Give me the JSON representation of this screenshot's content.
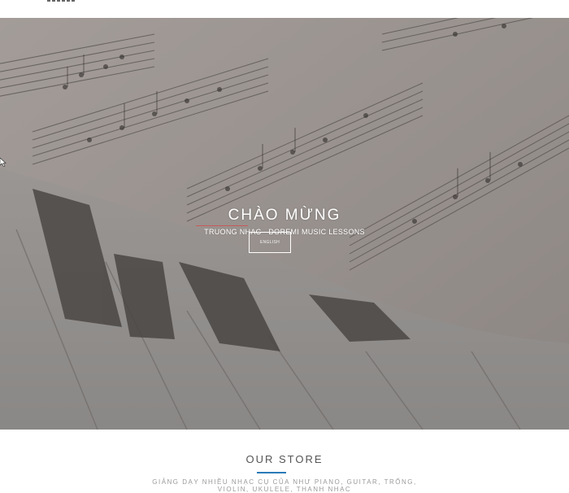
{
  "hero": {
    "title": "CHÀO MỪNG",
    "subtitle": "TRUONG NHAC  - DOREMI MUSIC LESSONS",
    "language_button": "ENGLISH"
  },
  "store": {
    "title": "OUR STORE",
    "description_line1": "GIẢNG DẠY NHIỀU NHẠC CỤ CỦA NHƯ PIANO, GUITAR, TRỐNG,",
    "description_line2": "VIOLIN, UKULELE, THANH NHẠC"
  },
  "colors": {
    "hero_overlay": "#8f8a87",
    "accent_underline": "#2a7ab8",
    "subtitle_underline": "#c95a5a"
  },
  "icons": [
    "logo-icon",
    "mouse-cursor-icon"
  ]
}
